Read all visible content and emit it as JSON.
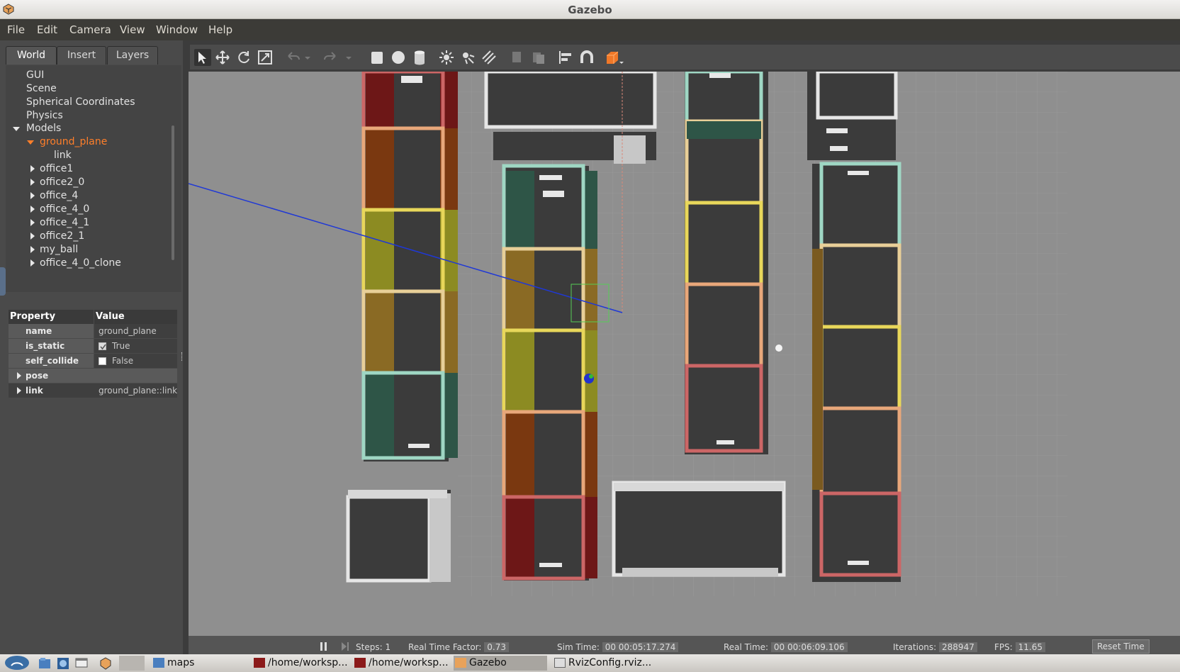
{
  "window": {
    "title": "Gazebo"
  },
  "menu": [
    "File",
    "Edit",
    "Camera",
    "View",
    "Window",
    "Help"
  ],
  "tabs": [
    "World",
    "Insert",
    "Layers"
  ],
  "tree": {
    "items": [
      {
        "label": "GUI"
      },
      {
        "label": "Scene"
      },
      {
        "label": "Spherical Coordinates"
      },
      {
        "label": "Physics"
      },
      {
        "label": "Models"
      },
      {
        "label": "ground_plane"
      },
      {
        "label": "link"
      },
      {
        "label": "office1"
      },
      {
        "label": "office2_0"
      },
      {
        "label": "office_4"
      },
      {
        "label": "office_4_0"
      },
      {
        "label": "office_4_1"
      },
      {
        "label": "office2_1"
      },
      {
        "label": "my_ball"
      },
      {
        "label": "office_4_0_clone"
      }
    ]
  },
  "properties": {
    "header_property": "Property",
    "header_value": "Value",
    "rows": [
      {
        "name": "name",
        "value": "ground_plane"
      },
      {
        "name": "is_static",
        "value": "True",
        "checked": true
      },
      {
        "name": "self_collide",
        "value": "False",
        "checked": false
      },
      {
        "name": "pose",
        "value": ""
      },
      {
        "name": "link",
        "value": "ground_plane::link"
      }
    ]
  },
  "toolbar": {
    "icons": [
      "select-arrow-icon",
      "translate-icon",
      "rotate-icon",
      "scale-icon",
      "undo-icon",
      "redo-icon",
      "box-icon",
      "sphere-icon",
      "cylinder-icon",
      "point-light-icon",
      "spot-light-icon",
      "directional-light-icon",
      "copy-icon",
      "paste-icon",
      "align-icon",
      "snap-icon",
      "change-view-icon"
    ]
  },
  "status": {
    "steps_label": "Steps:",
    "steps": "1",
    "rtf_label": "Real Time Factor:",
    "rtf": "0.73",
    "sim_label": "Sim Time:",
    "sim": "00 00:05:17.274",
    "real_label": "Real Time:",
    "real": "00 00:06:09.106",
    "iter_label": "Iterations:",
    "iter": "288947",
    "fps_label": "FPS:",
    "fps": "11.65",
    "reset_label": "Reset Time"
  },
  "taskbar": {
    "items": [
      "maps",
      "/home/worksp...",
      "/home/worksp...",
      "Gazebo",
      "RvizConfig.rviz..."
    ]
  },
  "colors": {
    "selected": "#ff7f2a",
    "viewport_bg": "#8e8e8e",
    "menubar_bg": "#3c3b37"
  }
}
